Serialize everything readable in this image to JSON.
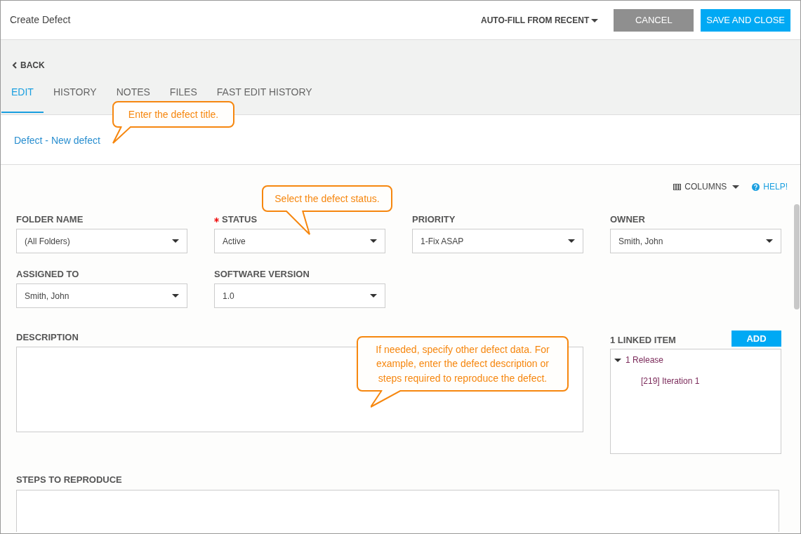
{
  "header": {
    "title": "Create Defect",
    "autofill": "AUTO-FILL FROM RECENT",
    "buttons": [
      {
        "label": "CANCEL",
        "kind": "secondary"
      },
      {
        "label": "SAVE AND CLOSE",
        "kind": "primary"
      }
    ]
  },
  "back": "BACK",
  "tabs": [
    {
      "label": "EDIT",
      "selected": true
    },
    {
      "label": "HISTORY",
      "selected": false
    },
    {
      "label": "NOTES",
      "selected": false
    },
    {
      "label": "FILES",
      "selected": false
    },
    {
      "label": "FAST EDIT HISTORY",
      "selected": false
    }
  ],
  "record_title": "Defect - New defect",
  "toolbar": {
    "columns": "COLUMNS",
    "help": "HELP!"
  },
  "field_rows": [
    [
      {
        "label": "FOLDER NAME",
        "value": "(All Folders)",
        "required": false
      },
      {
        "label": "STATUS",
        "value": "Active",
        "required": true
      },
      {
        "label": "PRIORITY",
        "value": "1-Fix ASAP",
        "required": false
      },
      {
        "label": "OWNER",
        "value": "Smith, John",
        "required": false
      }
    ],
    [
      {
        "label": "ASSIGNED TO",
        "value": "Smith, John",
        "required": false
      },
      {
        "label": "SOFTWARE VERSION",
        "value": "1.0",
        "required": false
      }
    ]
  ],
  "description": {
    "label": "DESCRIPTION"
  },
  "linked": {
    "title": "1 LINKED ITEM",
    "add": "ADD",
    "tree": [
      {
        "label": "1 Release",
        "expanded": true,
        "children": [
          {
            "label": "[219] Iteration 1"
          }
        ]
      }
    ]
  },
  "steps": {
    "label": "STEPS TO REPRODUCE"
  },
  "callouts": [
    {
      "text": "Enter the defect title."
    },
    {
      "text": "Select the defect status."
    },
    {
      "text": "If needed, specify other defect data. For example, enter the defect description or steps required to reproduce the defect."
    }
  ]
}
